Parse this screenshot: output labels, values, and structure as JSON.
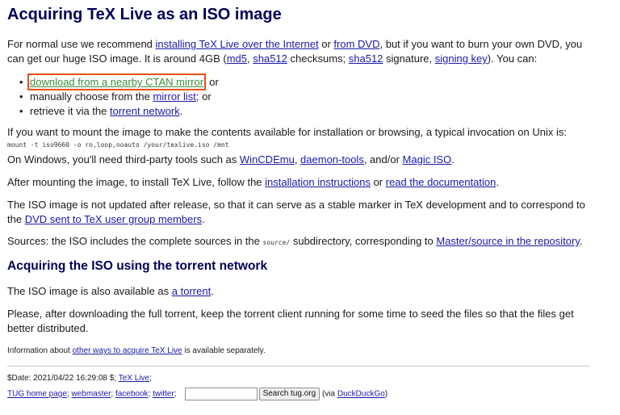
{
  "title": "Acquiring TeX Live as an ISO image",
  "intro": {
    "t1": "For normal use we recommend ",
    "link_internet": "installing TeX Live over the Internet",
    "t2": " or ",
    "link_dvd": "from DVD",
    "t3": ", but if you want to burn your own DVD, you can get our huge ISO image. It is around 4GB (",
    "link_md5": "md5",
    "t4": ", ",
    "link_sha512": "sha512",
    "t5": " checksums; ",
    "link_sha512_sig": "sha512",
    "t6": " signature, ",
    "link_signing_key": "signing key",
    "t7": "). You can:"
  },
  "options": {
    "item1_link": "download from a nearby CTAN mirror",
    "item1_rest": "; or",
    "item2_text": "manually choose from the ",
    "item2_link": "mirror list",
    "item2_rest": "; or",
    "item3_text": "retrieve it via the ",
    "item3_link": "torrent network",
    "item3_rest": "."
  },
  "mount": {
    "text": "If you want to mount the image to make the contents available for installation or browsing, a typical invocation on Unix is:",
    "command": "mount -t iso9660 -o ro,loop,noauto /your/texlive.iso /mnt"
  },
  "windows": {
    "t1": "On Windows, you'll need third-party tools such as ",
    "link_wincdemu": "WinCDEmu",
    "t2": ", ",
    "link_daemon": "daemon-tools",
    "t3": ", and/or ",
    "link_magiciso": "Magic ISO",
    "t4": "."
  },
  "after_mount": {
    "t1": "After mounting the image, to install TeX Live, follow the ",
    "link_instructions": "installation instructions",
    "t2": " or ",
    "link_docs": "read the documentation",
    "t3": "."
  },
  "not_updated": {
    "t1": "The ISO image is not updated after release, so that it can serve as a stable marker in TeX development and to correspond to the ",
    "link_dvd_sent": "DVD sent to TeX user group members",
    "t2": "."
  },
  "sources": {
    "t1": "Sources: the ISO includes the complete sources in the ",
    "code": "source/",
    "t2": " subdirectory, corresponding to ",
    "link_repo": "Master/source in the repository",
    "t3": "."
  },
  "torrent_heading": "Acquiring the ISO using the torrent network",
  "torrent": {
    "t1": "The ISO image is also available as ",
    "link": "a torrent",
    "t2": "."
  },
  "please": "Please, after downloading the full torrent, keep the torrent client running for some time to seed the files so that the files get better distributed.",
  "info": {
    "t1": "Information about ",
    "link": "other ways to acquire TeX Live",
    "t2": " is available separately."
  },
  "footer": {
    "date": "$Date: 2021/04/22 16:29:08 $; ",
    "link_texlive": "TeX Live",
    "sep1": ";",
    "link_tug": "TUG home page",
    "sep2": "; ",
    "link_webmaster": "webmaster",
    "sep3": "; ",
    "link_facebook": "facebook",
    "sep4": "; ",
    "link_twitter": "twitter",
    "sep5": ";",
    "search_placeholder": "",
    "search_button": "Search tug.org",
    "via_open": "(via ",
    "link_duckduckgo": "DuckDuckGo",
    "via_close": ")"
  },
  "colors": {
    "heading": "#00005a",
    "link": "#1a1aa6",
    "highlight_border": "#e8501c",
    "highlight_link": "#3c8e3c"
  }
}
